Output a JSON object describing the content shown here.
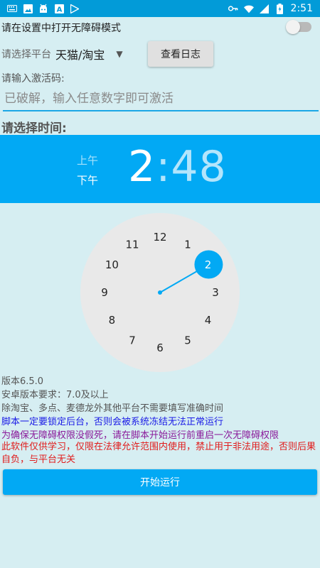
{
  "status_bar": {
    "time": "2:51",
    "left_icons": [
      "keyboard-icon",
      "image-icon",
      "android-icon",
      "text-a-icon",
      "play-store-icon"
    ],
    "right_icons": [
      "key-icon",
      "wifi-icon",
      "signal-icon",
      "battery-icon"
    ]
  },
  "accessibility": {
    "label": "请在设置中打开无障碍模式",
    "enabled": false
  },
  "platform": {
    "label": "请选择平台",
    "selected": "天猫/淘宝"
  },
  "log_button": {
    "label": "查看日志"
  },
  "activation": {
    "label": "请输入激活码:",
    "placeholder": "已破解，输入任意数字即可激活",
    "value": ""
  },
  "time_picker": {
    "title": "请选择时间:",
    "am_label": "上午",
    "pm_label": "下午",
    "selected_period": "pm",
    "hour": "2",
    "colon": ":",
    "minute": "48",
    "dial_numbers": [
      "12",
      "1",
      "2",
      "3",
      "4",
      "5",
      "6",
      "7",
      "8",
      "9",
      "10",
      "11"
    ],
    "selected_hour": 2,
    "accent_color": "#02a9f4"
  },
  "info": {
    "version": "版本6.5.0",
    "android_req": "安卓版本要求：7.0及以上",
    "note_time": "除淘宝、多点、麦德龙外其他平台不需要填写准确时间",
    "note_lock": "脚本一定要锁定后台，否则会被系统冻结无法正常运行",
    "note_restart": "为确保无障碍权限没假死，请在脚本开始运行前重启一次无障碍权限",
    "disclaimer": "此软件仅供学习，仅限在法律允许范围内使用，禁止用于非法用途，否则后果自负，与平台无关"
  },
  "colors": {
    "status_bar": "#029bd8",
    "primary": "#02a9f4",
    "background": "#d6eef2",
    "note_blue": "#1a1ae6",
    "note_purple": "#8a1a9a",
    "note_red": "#e11c1c"
  },
  "start_button": {
    "label": "开始运行"
  }
}
